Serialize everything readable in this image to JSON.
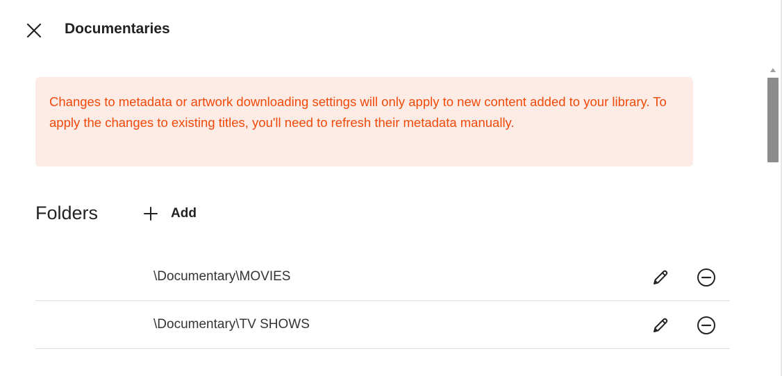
{
  "dialog": {
    "title": "Documentaries",
    "close_icon": "close-icon"
  },
  "alert": {
    "message": "Changes to metadata or artwork downloading settings will only apply to new content added to your library. To apply the changes to existing titles, you'll need to refresh their metadata manually.",
    "background_color": "#fdebe5",
    "text_color": "#f04a0a"
  },
  "folders": {
    "title": "Folders",
    "add_label": "Add",
    "add_icon": "plus-icon",
    "items": [
      {
        "path": "\\Documentary\\MOVIES",
        "edit_icon": "pencil-icon",
        "remove_icon": "minus-circle-icon"
      },
      {
        "path": "\\Documentary\\TV SHOWS",
        "edit_icon": "pencil-icon",
        "remove_icon": "minus-circle-icon"
      }
    ]
  }
}
